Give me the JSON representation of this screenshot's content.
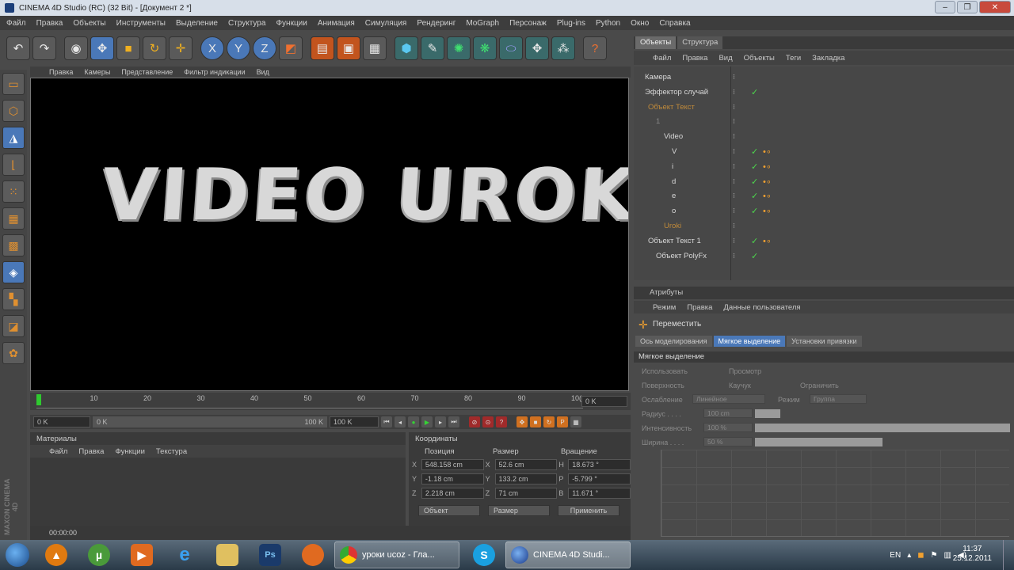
{
  "window": {
    "title": "CINEMA 4D Studio (RC) (32 Bit) - [Документ 2 *]",
    "minimize": "–",
    "maximize": "❐",
    "close": "✕"
  },
  "menubar": [
    "Файл",
    "Правка",
    "Объекты",
    "Инструменты",
    "Выделение",
    "Структура",
    "Функции",
    "Анимация",
    "Симуляция",
    "Рендеринг",
    "MoGraph",
    "Персонаж",
    "Plug-ins",
    "Python",
    "Окно",
    "Справка"
  ],
  "toolbar": {
    "icons": [
      "undo-icon",
      "redo-icon",
      "live-select-icon",
      "move-icon",
      "scale-icon",
      "rotate-icon",
      "add-icon",
      "x-axis-icon",
      "y-axis-icon",
      "z-axis-icon",
      "world-coordinate-icon",
      "render-view-icon",
      "render-picture-viewer-icon",
      "edit-render-settings-icon",
      "cube-icon",
      "pen-icon",
      "subdivision-icon",
      "array-icon",
      "deformer-icon",
      "scene-icon",
      "light-icon",
      "help-icon"
    ],
    "axis_labels": [
      "X",
      "Y",
      "Z"
    ]
  },
  "left_tools": [
    "make-editable-icon",
    "model-mode-icon",
    "texture-mode-icon",
    "axis-mode-icon",
    "points-mode-icon",
    "edges-mode-icon",
    "polygons-mode-icon",
    "uvw-mode-icon",
    "snap-icon",
    "workplane-icon",
    "sculpt-icon"
  ],
  "maxon_label": "MAXON CINEMA 4D",
  "viewport": {
    "menu": [
      "Правка",
      "Камеры",
      "Представление",
      "Фильтр индикации",
      "Вид"
    ],
    "render_text": "VIDEO UROKI"
  },
  "timeline": {
    "ticks": [
      "0",
      "10",
      "20",
      "30",
      "40",
      "50",
      "60",
      "70",
      "80",
      "90",
      "10("
    ],
    "frame_field": "0 K"
  },
  "transport": {
    "start": "0 K",
    "slider_left": "0 K",
    "slider_right": "100 K",
    "end": "100 K"
  },
  "materials": {
    "title": "Материалы",
    "menu": [
      "Файл",
      "Правка",
      "Функции",
      "Текстура"
    ]
  },
  "coordinates": {
    "title": "Координаты",
    "headers": [
      "Позиция",
      "Размер",
      "Вращение"
    ],
    "rows": [
      {
        "axis": "X",
        "pos": "548.158 cm",
        "size_axis": "X",
        "size": "52.6 cm",
        "rot_axis": "H",
        "rot": "18.673 °"
      },
      {
        "axis": "Y",
        "pos": "-1.18 cm",
        "size_axis": "Y",
        "size": "133.2 cm",
        "rot_axis": "P",
        "rot": "-5.799 °"
      },
      {
        "axis": "Z",
        "pos": "2.218 cm",
        "size_axis": "Z",
        "size": "71 cm",
        "rot_axis": "B",
        "rot": "11.671 °"
      }
    ],
    "dropdown_object": "Объект",
    "dropdown_size": "Размер",
    "apply": "Применить"
  },
  "status": {
    "time": "00:00:00"
  },
  "objects_panel": {
    "tabs": [
      "Объекты",
      "Структура"
    ],
    "menu": [
      "Файл",
      "Правка",
      "Вид",
      "Объекты",
      "Теги",
      "Закладка"
    ],
    "rows": [
      {
        "name": "Камера",
        "color": "#d8d8d8",
        "check": "",
        "tags": ""
      },
      {
        "name": "Эффектор случай",
        "color": "#d8d8d8",
        "check": "✓",
        "tags": ""
      },
      {
        "name": "Объект Текст",
        "color": "#c08a3a",
        "check": "",
        "tags": ""
      },
      {
        "name": "1",
        "color": "#888888",
        "check": "",
        "tags": ""
      },
      {
        "name": "Video",
        "color": "#d8d8d8",
        "check": "",
        "tags": ""
      },
      {
        "name": "V",
        "color": "#d8d8d8",
        "check": "✓",
        "tags": "•∘"
      },
      {
        "name": "i",
        "color": "#d8d8d8",
        "check": "✓",
        "tags": "•∘"
      },
      {
        "name": "d",
        "color": "#d8d8d8",
        "check": "✓",
        "tags": "•∘"
      },
      {
        "name": "e",
        "color": "#d8d8d8",
        "check": "✓",
        "tags": "•∘"
      },
      {
        "name": "o",
        "color": "#d8d8d8",
        "check": "✓",
        "tags": "•∘"
      },
      {
        "name": "Uroki",
        "color": "#c08a3a",
        "check": "",
        "tags": ""
      },
      {
        "name": "Объект Текст 1",
        "color": "#d8d8d8",
        "check": "✓",
        "tags": "•∘"
      },
      {
        "name": "Объект PolyFx",
        "color": "#d8d8d8",
        "check": "✓",
        "tags": ""
      }
    ]
  },
  "attributes": {
    "title": "Атрибуты",
    "menu": [
      "Режим",
      "Правка",
      "Данные пользователя"
    ],
    "tool": "Переместить",
    "tabs": [
      "Ось моделирования",
      "Мягкое выделение",
      "Установки привязки"
    ],
    "section": "Мягкое выделение",
    "use_label": "Использовать",
    "preview_label": "Просмотр",
    "surface_label": "Поверхность",
    "rubber_label": "Каучук",
    "limit_label": "Ограничить",
    "falloff_label": "Ослабление",
    "falloff_value": "Линейное",
    "mode_label": "Режим",
    "mode_value": "Группа",
    "radius_label": "Радиус . . . .",
    "radius_value": "100 cm",
    "intensity_label": "Интенсивность",
    "intensity_value": "100 %",
    "width_label": "Ширина . . . .",
    "width_value": "50 %",
    "intensity_fraction": 1.0,
    "width_fraction": 0.5
  },
  "taskbar": {
    "tasks": [
      {
        "label": "уроки ucoz - Гла...",
        "icon": "chrome-icon"
      },
      {
        "label": "CINEMA 4D Studi...",
        "icon": "cinema4d-icon"
      }
    ],
    "lang": "EN",
    "time": "11:37",
    "date": "25.12.2011"
  }
}
